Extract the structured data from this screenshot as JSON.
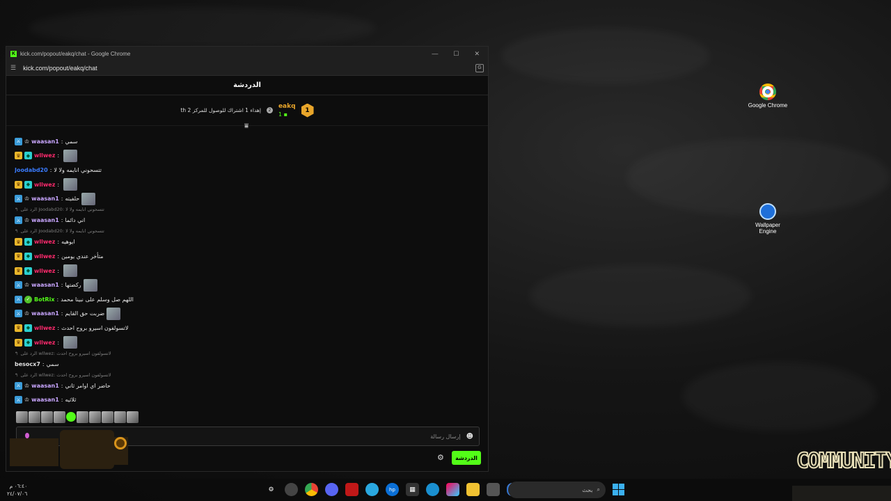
{
  "browser": {
    "title": "kick.com/popout/eakq/chat - Google Chrome",
    "url": "kick.com/popout/eakq/chat"
  },
  "chat": {
    "header": "الدردشة",
    "pinned": {
      "rank": "1",
      "username": "eakq",
      "count": "1",
      "goal_badge": "2",
      "goal_text": "إهداء 1 اشتراك للوصول للمركز 2 th"
    },
    "messages": [
      {
        "kind": "msg",
        "badges": [
          "mod"
        ],
        "user": "waasan1",
        "color": "#c9a6ff",
        "text": "سمي",
        "emote": false
      },
      {
        "kind": "msg",
        "badges": [
          "crown",
          "sub"
        ],
        "user": "wllwez",
        "color": "#ff2a6d",
        "text": "",
        "emote": true
      },
      {
        "kind": "msg",
        "badges": [],
        "user": "Joodabd20",
        "color": "#3a7bff",
        "text": "تتسحوني انايمه ولا لا",
        "emote": false
      },
      {
        "kind": "msg",
        "badges": [
          "crown",
          "sub"
        ],
        "user": "wllwez",
        "color": "#ff2a6d",
        "text": "",
        "emote": true
      },
      {
        "kind": "msg",
        "badges": [
          "mod"
        ],
        "user": "waasan1",
        "color": "#c9a6ff",
        "text": "حلفيته",
        "emote": true
      },
      {
        "kind": "reply",
        "text": "الرد على Joodabd20: تتسحوني انايمه ولا لا"
      },
      {
        "kind": "msg",
        "badges": [
          "mod"
        ],
        "user": "waasan1",
        "color": "#c9a6ff",
        "text": "اني دائما",
        "emote": false
      },
      {
        "kind": "reply",
        "text": "الرد على Joodabd20: تتسحوني انايمه ولا لا"
      },
      {
        "kind": "msg",
        "badges": [
          "crown",
          "sub"
        ],
        "user": "wllwez",
        "color": "#ff2a6d",
        "text": "ايوهيه",
        "emote": false
      },
      {
        "kind": "msg",
        "badges": [
          "crown",
          "sub"
        ],
        "user": "wllwez",
        "color": "#ff2a6d",
        "text": "متأخر عندي يومين",
        "emote": false
      },
      {
        "kind": "msg",
        "badges": [
          "crown",
          "sub"
        ],
        "user": "wllwez",
        "color": "#ff2a6d",
        "text": "",
        "emote": true
      },
      {
        "kind": "msg",
        "badges": [
          "mod"
        ],
        "user": "waasan1",
        "color": "#c9a6ff",
        "text": "ركضتها",
        "emote": true
      },
      {
        "kind": "msg",
        "badges": [
          "mod",
          "bot"
        ],
        "user": "BotRix",
        "color": "#53fc18",
        "text": "اللهم صل وسلم على نبينا محمد",
        "emote": false
      },
      {
        "kind": "msg",
        "badges": [
          "mod"
        ],
        "user": "waasan1",
        "color": "#c9a6ff",
        "text": "ضربت حق القايم",
        "emote": true
      },
      {
        "kind": "msg",
        "badges": [
          "crown",
          "sub"
        ],
        "user": "wllwez",
        "color": "#ff2a6d",
        "text": "لاتسولفون اسيرو بروح احدث",
        "emote": false
      },
      {
        "kind": "msg",
        "badges": [
          "crown",
          "sub"
        ],
        "user": "wllwez",
        "color": "#ff2a6d",
        "text": "",
        "emote": true
      },
      {
        "kind": "reply",
        "text": "الرد على wllwez: لاتسولفون اسيرو بروح احدث"
      },
      {
        "kind": "msg",
        "badges": [],
        "user": "besocx7",
        "color": "#e0e0e0",
        "text": "سمي",
        "emote": false
      },
      {
        "kind": "reply",
        "text": "الرد على wllwez: لاتسولفون اسيرو بروح احدث"
      },
      {
        "kind": "msg",
        "badges": [
          "mod"
        ],
        "user": "waasan1",
        "color": "#c9a6ff",
        "text": "حاضر اي اوامر ثاني",
        "emote": false
      },
      {
        "kind": "msg",
        "badges": [
          "mod"
        ],
        "user": "waasan1",
        "color": "#c9a6ff",
        "text": "ثلاثيه",
        "emote": false
      }
    ],
    "input_placeholder": "إرسال رسالة",
    "send_label": "الدردشة"
  },
  "desktop": {
    "icons": [
      {
        "label": "Google Chrome"
      },
      {
        "label": "Wallpaper Engine"
      }
    ],
    "community_text": "COMMUNITY"
  },
  "taskbar": {
    "search_label": "بحث",
    "clock_time": "٠٦:٤٠ م",
    "clock_date": "٢٤/٠٧/٠٦"
  }
}
